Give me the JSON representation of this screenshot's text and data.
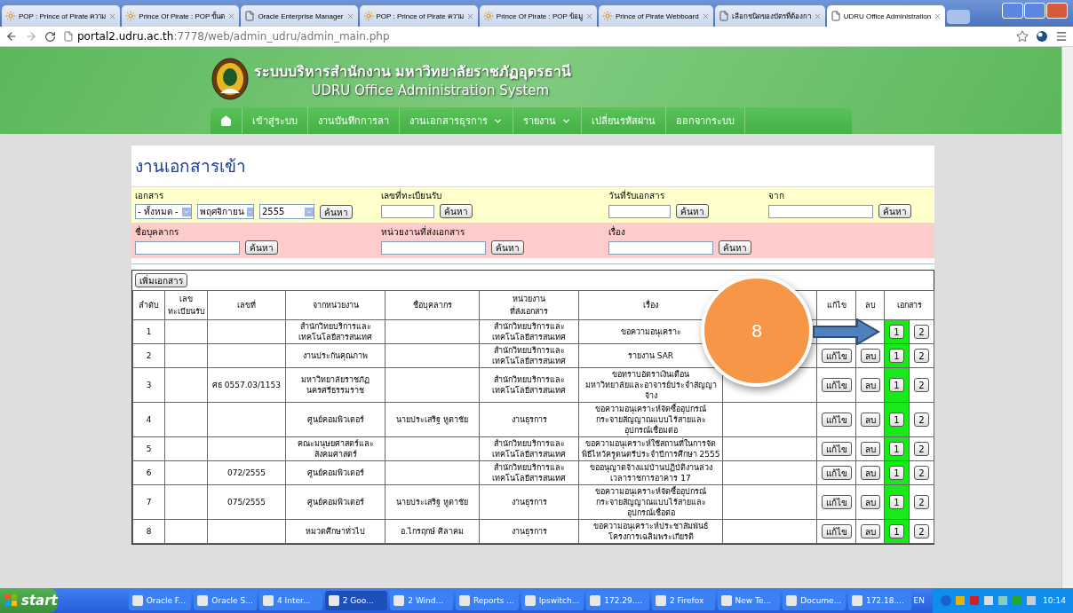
{
  "browser_tabs": [
    {
      "title": "POP : Prince of Pirate ความ",
      "kind": "pirate",
      "selected": false
    },
    {
      "title": "Prince Of Pirate : POP ขั้นต",
      "kind": "pirate",
      "selected": false
    },
    {
      "title": "Oracle Enterprise Manager",
      "kind": "page",
      "selected": false
    },
    {
      "title": "POP : Prince of Pirate ความ",
      "kind": "pirate",
      "selected": false
    },
    {
      "title": "Prince Of Pirate : POP ข้อมู",
      "kind": "pirate",
      "selected": false
    },
    {
      "title": "Prince of Pirate Webboard",
      "kind": "pirate",
      "selected": false
    },
    {
      "title": "เลือกชนิดของบัตรที่ต้องกา",
      "kind": "page",
      "selected": false
    },
    {
      "title": "UDRU Office Administration",
      "kind": "page",
      "selected": true
    }
  ],
  "address_bar": {
    "host": "portal2.udru.ac.th",
    "path": ":7778/web/admin_udru/admin_main.php"
  },
  "header": {
    "title_thai": "ระบบบริหารสำนักงาน มหาวิทยาลัยราชภัฏอุดรธานี",
    "title_english": "UDRU Office Administration System"
  },
  "menu": [
    {
      "label": "เข้าสู่ระบบ",
      "dropdown": false
    },
    {
      "label": "งานบันทึกการลา",
      "dropdown": false
    },
    {
      "label": "งานเอกสารธุรการ",
      "dropdown": true
    },
    {
      "label": "รายงาน",
      "dropdown": true
    },
    {
      "label": "เปลี่ยนรหัสผ่าน",
      "dropdown": false
    },
    {
      "label": "ออกจากระบบ",
      "dropdown": false
    }
  ],
  "page_title": "งานเอกสารเข้า",
  "filters": {
    "row_1": [
      {
        "label": "เอกสาร",
        "selects": [
          "- ทั้งหมด -",
          "พฤศจิกายน",
          "2555"
        ],
        "button": "ค้นหา"
      },
      {
        "label": "เลขที่ทะเบียนรับ",
        "button": "ค้นหา"
      },
      {
        "label": "วันที่รับเอกสาร",
        "button": "ค้นหา"
      },
      {
        "label": "จาก",
        "button": "ค้นหา"
      }
    ],
    "row_2": [
      {
        "label": "ชื่อบุคลากร",
        "button": "ค้นหา"
      },
      {
        "label": "หน่วยงานที่ส่งเอกสาร",
        "button": "ค้นหา"
      },
      {
        "label": "เรื่อง",
        "button": "ค้นหา"
      }
    ]
  },
  "table": {
    "add_button": "เพิ่มเอกสาร",
    "columns": [
      "ลำดับ",
      "เลข\nทะเบียนรับ",
      "เลขที่",
      "จากหน่วยงาน",
      "ชื่อบุคลากร",
      "หน่วยงาน\nที่ส่งเอกสาร",
      "เรื่อง",
      "",
      "แก้ไข",
      "ลบ",
      "เอกสาร"
    ],
    "rows": [
      {
        "cells": [
          "1",
          "",
          "",
          "สำนักวิทยบริการและ\nเทคโนโลยีสารสนเทศ",
          "",
          "สำนักวิทยบริการและ\nเทคโนโลยีสารสนเทศ",
          "ขอความอนุเคราะ"
        ],
        "doc_buttons": [
          "1",
          "2"
        ]
      },
      {
        "cells": [
          "2",
          "",
          "",
          "งานประกันคุณภาพ",
          "",
          "สำนักวิทยบริการและ\nเทคโนโลยีสารสนเทศ",
          "รายงาน SAR"
        ],
        "edit": "แก้ไข",
        "delete": "ลบ",
        "doc_buttons": [
          "1",
          "2"
        ]
      },
      {
        "cells": [
          "3",
          "",
          "ศธ 0557.03/1153",
          "มหาวิทยาลัยราชภัฏ\nนครศรีธรรมราช",
          "",
          "สำนักวิทยบริการและ\nเทคโนโลยีสารสนเทศ",
          "ขอทราบอัตราเงินเดือน\nมหาวิทยาลัยและอาจารย์ประจำสัญญา\nจ้าง"
        ],
        "edit": "แก้ไข",
        "delete": "ลบ",
        "doc_buttons": [
          "1",
          "2"
        ]
      },
      {
        "cells": [
          "4",
          "",
          "",
          "ศูนย์คอมพิวเตอร์",
          "นายประเสริฐ หูตาชัย",
          "งานธุรการ",
          "ขอความอนุเคราะห์จัดซื้ออุปกรณ์\nกระจายสัญญาณแบบไร้สายและ\nอุปกรณ์เชื่อมต่อ"
        ],
        "edit": "แก้ไข",
        "delete": "ลบ",
        "doc_buttons": [
          "1",
          "2"
        ]
      },
      {
        "cells": [
          "5",
          "",
          "",
          "คณะมนุษยศาสตร์และ\nสังคมศาสตร์",
          "",
          "สำนักวิทยบริการและ\nเทคโนโลยีสารสนเทศ",
          "ขอความอนุเคราะห์ใช้สถานที่ในการจัด\nพิธีไหว้ครูดนตรีประจำปีการศึกษา 2555"
        ],
        "edit": "แก้ไข",
        "delete": "ลบ",
        "doc_buttons": [
          "1",
          "2"
        ]
      },
      {
        "cells": [
          "6",
          "",
          "072/2555",
          "ศูนย์คอมพิวเตอร์",
          "",
          "สำนักวิทยบริการและ\nเทคโนโลยีสารสนเทศ",
          "ขออนุญาตจ้างแม่บ้านปฏิบัติงานล่วง\nเวลาราชการอาคาร 17"
        ],
        "edit": "แก้ไข",
        "delete": "ลบ",
        "doc_buttons": [
          "1",
          "2"
        ]
      },
      {
        "cells": [
          "7",
          "",
          "075/2555",
          "ศูนย์คอมพิวเตอร์",
          "นายประเสริฐ หูตาชัย",
          "งานธุรการ",
          "ขอความอนุเคราะห์จัดซื้ออุปกรณ์\nกระจายสัญญาณแบบไร้สายและ\nอุปกรณ์เชื่อต่อ"
        ],
        "edit": "แก้ไข",
        "delete": "ลบ",
        "doc_buttons": [
          "1",
          "2"
        ]
      },
      {
        "cells": [
          "8",
          "",
          "",
          "หมวดศึกษาทั่วไป",
          "อ.ไกรฤกษ์ ศิลาคม",
          "งานธุรการ",
          "ขอความอนุเคราะห์ประชาสัมพันธ์\nโครงการเฉลิมพระเกียรติ"
        ],
        "edit": "แก้ไข",
        "delete": "ลบ",
        "doc_buttons": [
          "1",
          "2"
        ]
      }
    ]
  },
  "annotation": {
    "label": "8"
  },
  "taskbar": {
    "start": "start",
    "items": [
      {
        "label": "Oracle F...",
        "selected": false
      },
      {
        "label": "Oracle S...",
        "selected": false
      },
      {
        "label": "4 Inter...",
        "selected": false
      },
      {
        "label": "2 Goo...",
        "selected": true
      },
      {
        "label": "2 Wind...",
        "selected": false
      },
      {
        "label": "Reports ...",
        "selected": false
      },
      {
        "label": "Ipswitch...",
        "selected": false
      },
      {
        "label": "172.29....",
        "selected": false
      },
      {
        "label": "2 Firefox",
        "selected": false
      },
      {
        "label": "New Te...",
        "selected": false
      },
      {
        "label": "Docume...",
        "selected": false
      },
      {
        "label": "172.18....",
        "selected": false
      }
    ],
    "language": "EN",
    "clock": "10:14"
  }
}
